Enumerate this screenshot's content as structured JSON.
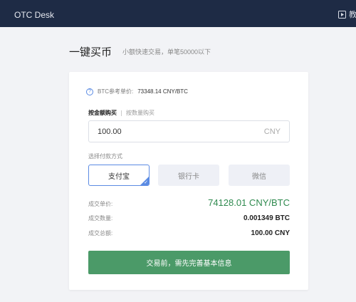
{
  "topbar": {
    "brand": "OTC Desk",
    "tutorial_label": "教程"
  },
  "page": {
    "title": "一键买币",
    "subtitle": "小额快速交易，单笔50000以下"
  },
  "reference": {
    "label": "BTC参考单价:",
    "value": "73348.14 CNY/BTC"
  },
  "modes": {
    "active": "按金额购买",
    "inactive": "按数量购买"
  },
  "amount_input": {
    "value": "100.00",
    "unit": "CNY"
  },
  "payment": {
    "label": "选择付款方式",
    "options": [
      "支付宝",
      "银行卡",
      "微信"
    ],
    "selected": "支付宝"
  },
  "summary": {
    "price_label": "成交单价:",
    "price_value": "74128.01 CNY/BTC",
    "qty_label": "成交数量:",
    "qty_value": "0.001349 BTC",
    "total_label": "成交总额:",
    "total_value": "100.00 CNY"
  },
  "submit_label": "交易前，需先完善基本信息",
  "colors": {
    "topbar": "#1e2b45",
    "accent_blue": "#5b8be3",
    "accent_green": "#4b9a68",
    "price_green": "#2f8a4f"
  }
}
